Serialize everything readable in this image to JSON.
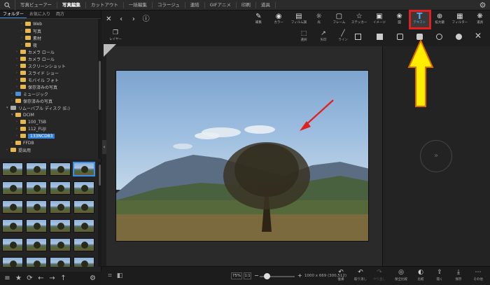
{
  "menu": {
    "items": [
      "写真ビューアー",
      "写真編集",
      "カットアウト",
      "一括編集",
      "コラージュ",
      "連結",
      "GIFアニメ",
      "印刷",
      "道具"
    ],
    "active_index": 1
  },
  "left_panel": {
    "tabs": [
      "フォルダー",
      "お気に入り",
      "両方"
    ],
    "tree": [
      {
        "label": "Web",
        "depth": 4,
        "type": "folder",
        "expanded": false
      },
      {
        "label": "写真",
        "depth": 4,
        "type": "folder",
        "expanded": false
      },
      {
        "label": "素材",
        "depth": 4,
        "type": "folder",
        "expanded": false
      },
      {
        "label": "夜",
        "depth": 4,
        "type": "folder",
        "expanded": false
      },
      {
        "label": "カメラ ロール",
        "depth": 3,
        "type": "folder",
        "expanded": false
      },
      {
        "label": "カメラ ロール",
        "depth": 3,
        "type": "folder",
        "expanded": false
      },
      {
        "label": "スクリーンショット",
        "depth": 3,
        "type": "folder",
        "expanded": false
      },
      {
        "label": "スライド ショー",
        "depth": 3,
        "type": "folder",
        "expanded": false
      },
      {
        "label": "モバイル フォト",
        "depth": 3,
        "type": "folder",
        "expanded": false
      },
      {
        "label": "保存済みの写真",
        "depth": 3,
        "type": "folder",
        "expanded": false
      },
      {
        "label": "ミュージック",
        "depth": 2,
        "type": "blue",
        "expanded": false
      },
      {
        "label": "保存済みの写真",
        "depth": 2,
        "type": "folder",
        "expanded": false
      },
      {
        "label": "リムーバブル ディスク (E:)",
        "depth": 1,
        "type": "drive",
        "expanded": true
      },
      {
        "label": "DCIM",
        "depth": 2,
        "type": "folder",
        "expanded": true
      },
      {
        "label": "100_TSB",
        "depth": 3,
        "type": "folder",
        "expanded": false
      },
      {
        "label": "112_FUJI",
        "depth": 3,
        "type": "folder",
        "expanded": false
      },
      {
        "label": "133NCD83",
        "depth": 3,
        "type": "folder",
        "expanded": false,
        "selected": true
      },
      {
        "label": "FFDB",
        "depth": 2,
        "type": "folder",
        "expanded": false
      },
      {
        "label": "提出用",
        "depth": 1,
        "type": "folder",
        "expanded": false
      }
    ]
  },
  "toolbar": {
    "tools": [
      {
        "icon": "edit-icon",
        "glyph": "✎",
        "label": "補集"
      },
      {
        "icon": "vignette-icon",
        "glyph": "◉",
        "label": "カラー"
      },
      {
        "icon": "film-icon",
        "glyph": "▤",
        "label": "フィルム調"
      },
      {
        "icon": "light-icon",
        "glyph": "☼",
        "label": "光"
      },
      {
        "icon": "frame-icon",
        "glyph": "▢",
        "label": "フレーム"
      },
      {
        "icon": "sticker-icon",
        "glyph": "☆",
        "label": "ステッカー"
      },
      {
        "icon": "image-icon",
        "glyph": "▣",
        "label": "イメージ"
      },
      {
        "icon": "mosaic-icon",
        "glyph": "❀",
        "label": "図"
      },
      {
        "icon": "text-icon",
        "glyph": "T",
        "label": "テキスト",
        "active": true
      },
      {
        "icon": "zoom-icon",
        "glyph": "⊕",
        "label": "拡大鏡"
      },
      {
        "icon": "filter-icon",
        "glyph": "▦",
        "label": "フィルター"
      },
      {
        "icon": "clone-icon",
        "glyph": "❋",
        "label": "道具"
      }
    ]
  },
  "subtools": {
    "layer_label": "レイヤー",
    "items": [
      {
        "glyph": "⬚",
        "label": "選択"
      },
      {
        "glyph": "↗",
        "label": "矢印"
      },
      {
        "glyph": "╱",
        "label": "ライン"
      }
    ]
  },
  "status": {
    "zoom": "75%",
    "fit": "1:1",
    "dimensions": "1000 x 669 (300,512)",
    "buttons": [
      {
        "glyph": "↶",
        "label": "復帰",
        "enabled": true
      },
      {
        "glyph": "↶",
        "label": "取り消し",
        "enabled": true
      },
      {
        "glyph": "↷",
        "label": "やり直し",
        "enabled": false
      },
      {
        "glyph": "◎",
        "label": "保全比較",
        "enabled": true
      },
      {
        "glyph": "◐",
        "label": "比較",
        "enabled": true
      },
      {
        "glyph": "⇪",
        "label": "開く",
        "enabled": true
      },
      {
        "glyph": "⤓",
        "label": "保存",
        "enabled": true
      },
      {
        "glyph": "⋯",
        "label": "その他",
        "enabled": true
      }
    ]
  },
  "colors": {
    "accent": "#3a8ee6",
    "highlight": "#e02020",
    "arrow_fill": "#ffee00",
    "arrow_stroke": "#e06a00"
  }
}
